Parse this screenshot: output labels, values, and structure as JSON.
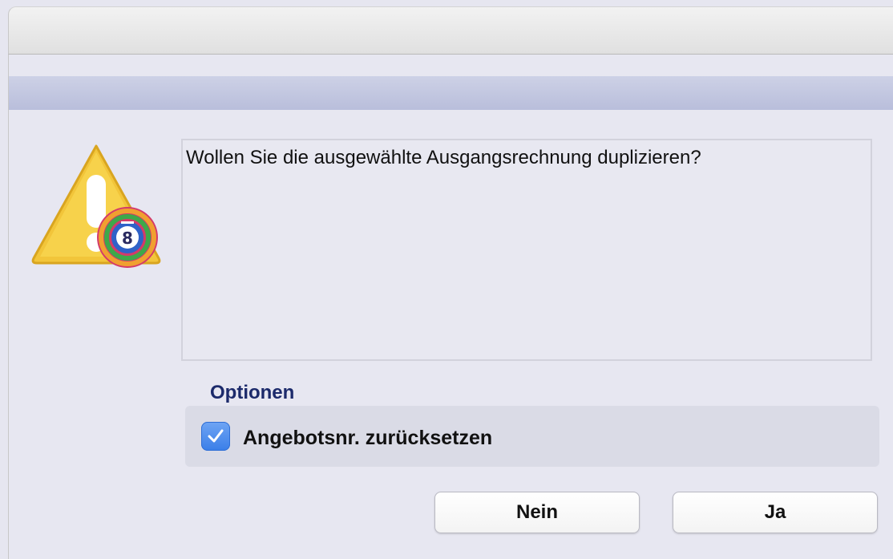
{
  "dialog": {
    "message": "Wollen Sie die ausgewählte Ausgangsrechnung duplizieren?",
    "icon": "warning-icon",
    "options": {
      "title": "Optionen",
      "checkbox_label": "Angebotsnr. zurücksetzen",
      "checkbox_checked": true
    },
    "buttons": {
      "no_label": "Nein",
      "yes_label": "Ja"
    }
  },
  "colors": {
    "accent": "#3a7ee8",
    "options_title": "#1c2a6b",
    "warning": "#f2c53a"
  }
}
